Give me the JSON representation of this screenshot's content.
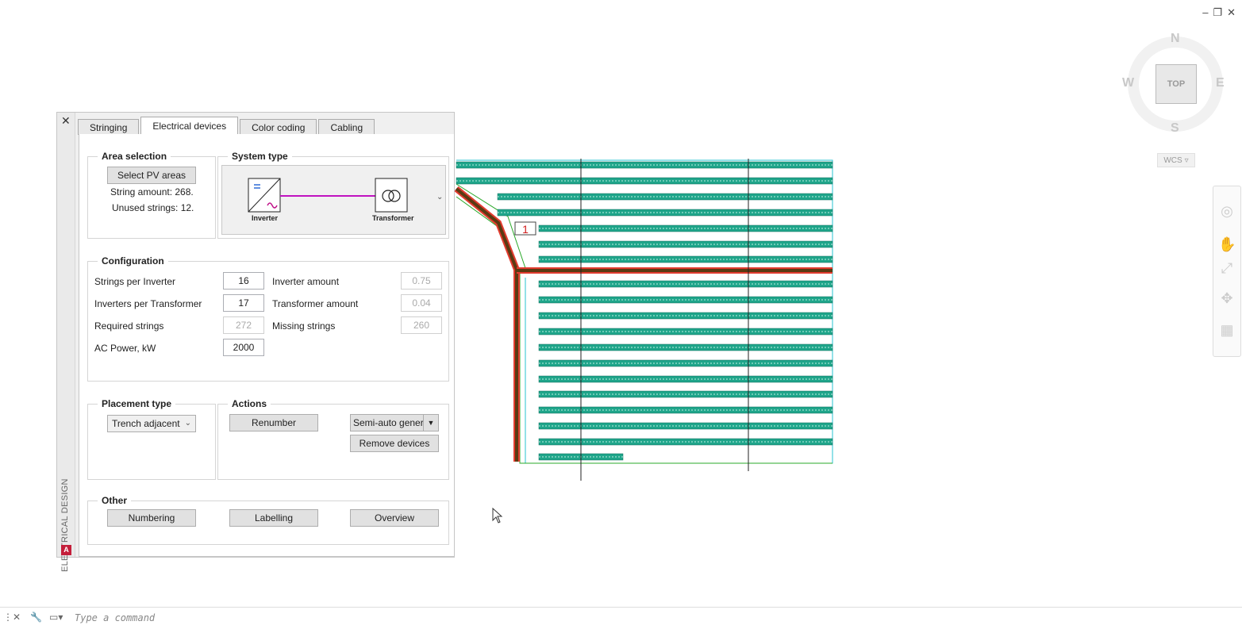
{
  "window_controls": [
    "–",
    "❐",
    "✕"
  ],
  "viewcube": {
    "face": "TOP",
    "north": "N",
    "south": "S",
    "east": "E",
    "west": "W",
    "ucs": "WCS"
  },
  "palette": {
    "side_title": "ELECTRICAL DESIGN",
    "logo": "A",
    "tabs": [
      "Stringing",
      "Electrical devices",
      "Color coding",
      "Cabling"
    ],
    "active_tab": "Electrical devices",
    "area_selection": {
      "title": "Area selection",
      "select_button": "Select PV areas",
      "string_amount": "String amount: 268.",
      "unused_strings": "Unused strings: 12."
    },
    "system_type": {
      "title": "System type",
      "inverter_label": "Inverter",
      "transformer_label": "Transformer"
    },
    "configuration": {
      "title": "Configuration",
      "strings_per_inverter": {
        "label": "Strings per Inverter",
        "value": "16"
      },
      "inverters_per_transformer": {
        "label": "Inverters per Transformer",
        "value": "17"
      },
      "required_strings": {
        "label": "Required strings",
        "value": "272"
      },
      "ac_power": {
        "label": "AC Power, kW",
        "value": "2000"
      },
      "inverter_amount": {
        "label": "Inverter amount",
        "value": "0.75"
      },
      "transformer_amount": {
        "label": "Transformer amount",
        "value": "0.04"
      },
      "missing_strings": {
        "label": "Missing strings",
        "value": "260"
      }
    },
    "placement_type": {
      "title": "Placement type",
      "value": "Trench adjacent"
    },
    "actions": {
      "title": "Actions",
      "renumber": "Renumber",
      "generate_mode": "Semi-auto gener",
      "remove_devices": "Remove devices"
    },
    "other": {
      "title": "Other",
      "numbering": "Numbering",
      "labelling": "Labelling",
      "overview": "Overview"
    }
  },
  "drawing": {
    "block_number": "1"
  },
  "command_line": {
    "placeholder": "Type a command"
  }
}
